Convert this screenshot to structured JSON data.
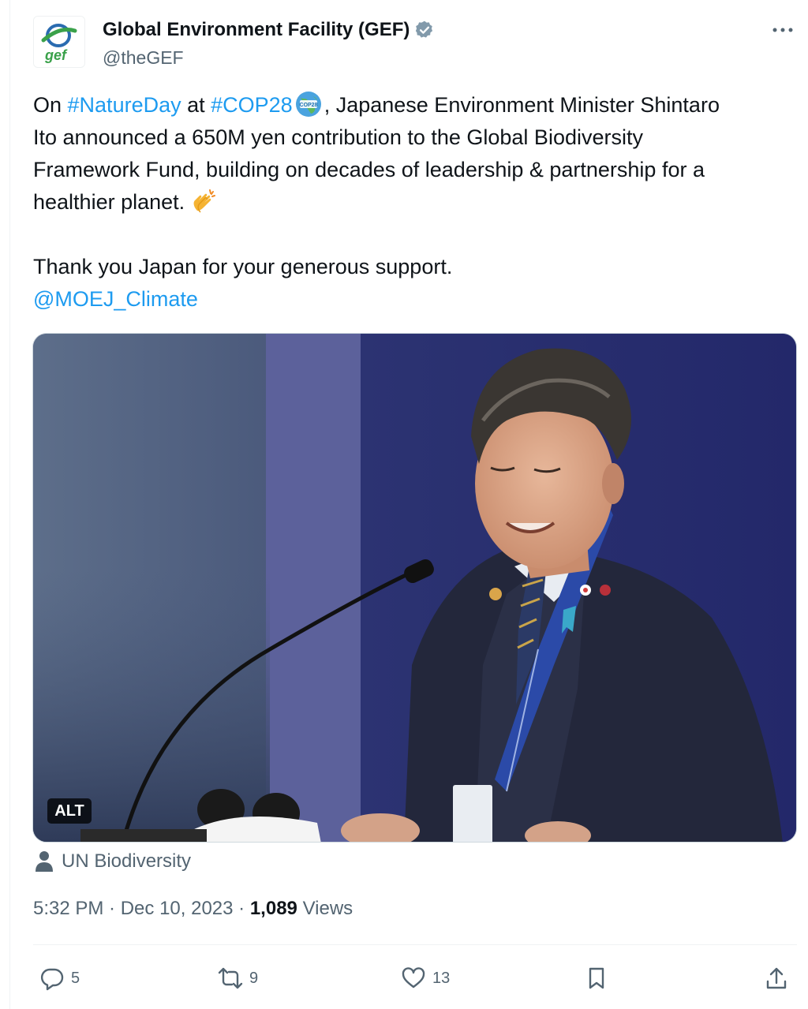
{
  "author": {
    "name": "Global Environment Facility (GEF)",
    "handle": "@theGEF",
    "logo_text": "gef"
  },
  "tweet": {
    "line1": {
      "a": "On ",
      "b": "#NatureDay",
      "c": " at ",
      "d": "#COP28",
      "e": ", Japanese Environment Minister Shintaro"
    },
    "line2": "Ito announced a 650M yen contribution to the Global Biodiversity",
    "line3": "Framework Fund, building on decades of leadership & partnership for a",
    "line4": "healthier planet.",
    "line5": "Thank you Japan for your generous support.",
    "mention": "@MOEJ_Climate"
  },
  "media": {
    "alt_label": "ALT"
  },
  "tag": {
    "label": "UN Biodiversity"
  },
  "meta": {
    "time": "5:32 PM",
    "sep": " · ",
    "date": "Dec 10, 2023",
    "views_count": "1,089",
    "views_label": "Views"
  },
  "actions": {
    "replies": "5",
    "reposts": "9",
    "likes": "13"
  },
  "colors": {
    "link": "#1d9bf0",
    "secondary_text": "#536471",
    "primary_text": "#0f1419",
    "verified": "#829aab"
  }
}
